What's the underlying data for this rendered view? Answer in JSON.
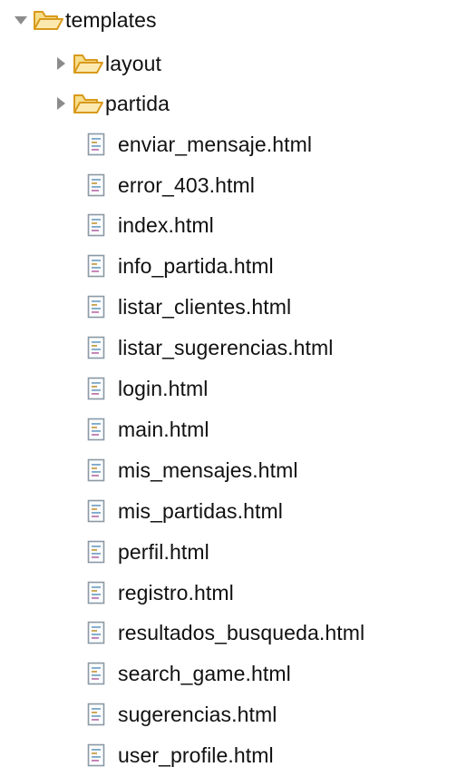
{
  "tree": {
    "root": {
      "label": "templates",
      "icon": "folder-open-icon",
      "expanded": true
    },
    "folders": [
      {
        "label": "layout",
        "icon": "folder-open-icon",
        "expanded": false
      },
      {
        "label": "partida",
        "icon": "folder-open-icon",
        "expanded": false
      }
    ],
    "files": [
      {
        "label": "enviar_mensaje.html",
        "icon": "html-file-icon"
      },
      {
        "label": "error_403.html",
        "icon": "html-file-icon"
      },
      {
        "label": "index.html",
        "icon": "html-file-icon"
      },
      {
        "label": "info_partida.html",
        "icon": "html-file-icon"
      },
      {
        "label": "listar_clientes.html",
        "icon": "html-file-icon"
      },
      {
        "label": "listar_sugerencias.html",
        "icon": "html-file-icon"
      },
      {
        "label": "login.html",
        "icon": "html-file-icon"
      },
      {
        "label": "main.html",
        "icon": "html-file-icon"
      },
      {
        "label": "mis_mensajes.html",
        "icon": "html-file-icon"
      },
      {
        "label": "mis_partidas.html",
        "icon": "html-file-icon"
      },
      {
        "label": "perfil.html",
        "icon": "html-file-icon"
      },
      {
        "label": "registro.html",
        "icon": "html-file-icon"
      },
      {
        "label": "resultados_busqueda.html",
        "icon": "html-file-icon"
      },
      {
        "label": "search_game.html",
        "icon": "html-file-icon"
      },
      {
        "label": "sugerencias.html",
        "icon": "html-file-icon"
      },
      {
        "label": "user_profile.html",
        "icon": "html-file-icon"
      }
    ]
  },
  "colors": {
    "folder_fill": "#f6dd8a",
    "folder_stroke": "#d99a1c",
    "file_stroke": "#8a9aa6",
    "twisty": "#8c8c8c"
  }
}
